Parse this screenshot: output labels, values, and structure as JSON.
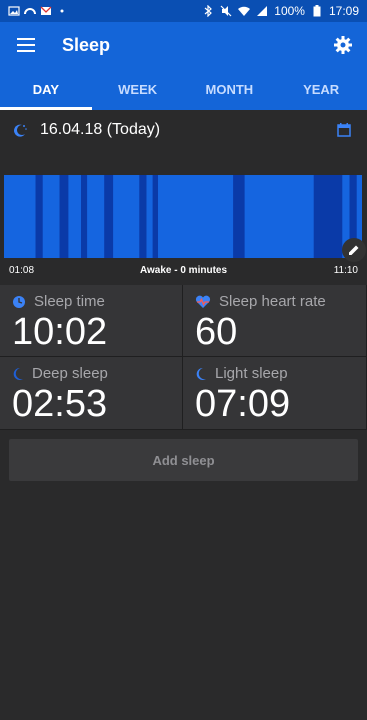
{
  "status_bar": {
    "battery": "100%",
    "time": "17:09"
  },
  "app": {
    "title": "Sleep"
  },
  "tabs": [
    {
      "label": "DAY",
      "active": true
    },
    {
      "label": "WEEK",
      "active": false
    },
    {
      "label": "MONTH",
      "active": false
    },
    {
      "label": "YEAR",
      "active": false
    }
  ],
  "date": {
    "label": "16.04.18 (Today)"
  },
  "timeline": {
    "start": "01:08",
    "end": "11:10",
    "awake_label": "Awake - 0 minutes",
    "light_color": "#1565e0",
    "deep_color": "#0a3aa8",
    "deep_segments": [
      {
        "from": 0.088,
        "to": 0.108
      },
      {
        "from": 0.155,
        "to": 0.18
      },
      {
        "from": 0.215,
        "to": 0.232
      },
      {
        "from": 0.28,
        "to": 0.305
      },
      {
        "from": 0.378,
        "to": 0.398
      },
      {
        "from": 0.415,
        "to": 0.43
      },
      {
        "from": 0.64,
        "to": 0.672
      },
      {
        "from": 0.865,
        "to": 0.945
      },
      {
        "from": 0.965,
        "to": 0.985
      }
    ]
  },
  "stats": {
    "sleep_time": {
      "label": "Sleep time",
      "value": "10:02"
    },
    "heart_rate": {
      "label": "Sleep heart rate",
      "value": "60"
    },
    "deep_sleep": {
      "label": "Deep sleep",
      "value": "02:53"
    },
    "light_sleep": {
      "label": "Light sleep",
      "value": "07:09"
    }
  },
  "add_sleep": {
    "label": "Add sleep"
  },
  "colors": {
    "primary": "#1465d8",
    "status": "#0a4fb3",
    "accent": "#3b82f6"
  }
}
